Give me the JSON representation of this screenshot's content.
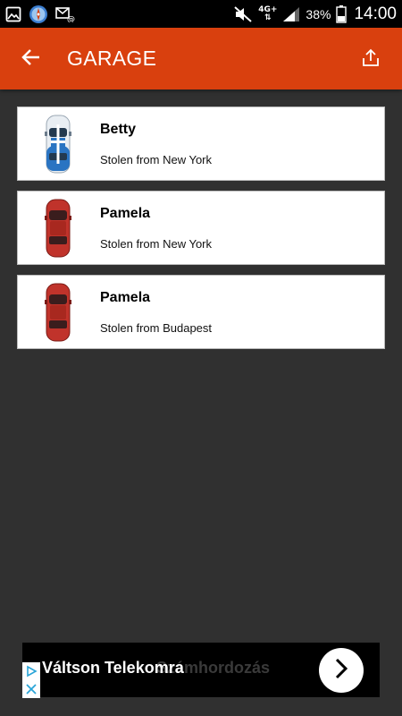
{
  "status_bar": {
    "network_type": "4G+",
    "network_arrows": "⇅",
    "battery_percent": "38%",
    "time": "14:00"
  },
  "app_bar": {
    "title": "GARAGE",
    "back_icon": "arrow-left-icon",
    "share_icon": "upload-share-icon",
    "color": "#D9400E"
  },
  "garage": {
    "cars": [
      {
        "name": "Betty",
        "origin": "Stolen from New York",
        "color": "blue-white"
      },
      {
        "name": "Pamela",
        "origin": "Stolen from New York",
        "color": "red"
      },
      {
        "name": "Pamela",
        "origin": "Stolen from Budapest",
        "color": "red"
      }
    ]
  },
  "ad": {
    "headline": "Váltson Telekomra",
    "ghost_text": "Számhordozás"
  }
}
